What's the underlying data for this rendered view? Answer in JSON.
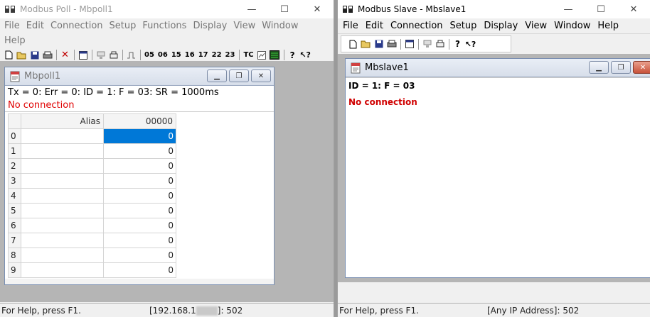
{
  "poll": {
    "title": "Modbus Poll - Mbpoll1",
    "menu": [
      "File",
      "Edit",
      "Connection",
      "Setup",
      "Functions",
      "Display",
      "View",
      "Window",
      "Help"
    ],
    "toolbar_function_codes": [
      "05",
      "06",
      "15",
      "16",
      "17",
      "22",
      "23"
    ],
    "toolbar_tc": "TC",
    "child_title": "Mbpoll1",
    "status_line": "Tx = 0: Err = 0: ID = 1: F = 03: SR = 1000ms",
    "connection_status": "No connection",
    "table": {
      "headers": [
        "Alias",
        "00000"
      ],
      "rows": [
        {
          "index": "0",
          "alias": "",
          "value": "0",
          "selected": true
        },
        {
          "index": "1",
          "alias": "",
          "value": "0"
        },
        {
          "index": "2",
          "alias": "",
          "value": "0"
        },
        {
          "index": "3",
          "alias": "",
          "value": "0"
        },
        {
          "index": "4",
          "alias": "",
          "value": "0"
        },
        {
          "index": "5",
          "alias": "",
          "value": "0"
        },
        {
          "index": "6",
          "alias": "",
          "value": "0"
        },
        {
          "index": "7",
          "alias": "",
          "value": "0"
        },
        {
          "index": "8",
          "alias": "",
          "value": "0"
        },
        {
          "index": "9",
          "alias": "",
          "value": "0"
        }
      ]
    },
    "statusbar": {
      "help": "For Help, press F1.",
      "address_prefix": "[192.168.1",
      "address_suffix": "]: 502"
    }
  },
  "slave": {
    "title": "Modbus Slave - Mbslave1",
    "menu": [
      "File",
      "Edit",
      "Connection",
      "Setup",
      "Display",
      "View",
      "Window",
      "Help"
    ],
    "child_title": "Mbslave1",
    "status_line": "ID = 1: F = 03",
    "connection_status": "No connection",
    "statusbar": {
      "help": "For Help, press F1.",
      "address": "[Any IP Address]: 502"
    }
  },
  "colors": {
    "selection": "#0078d7",
    "error_text": "#e00000"
  }
}
